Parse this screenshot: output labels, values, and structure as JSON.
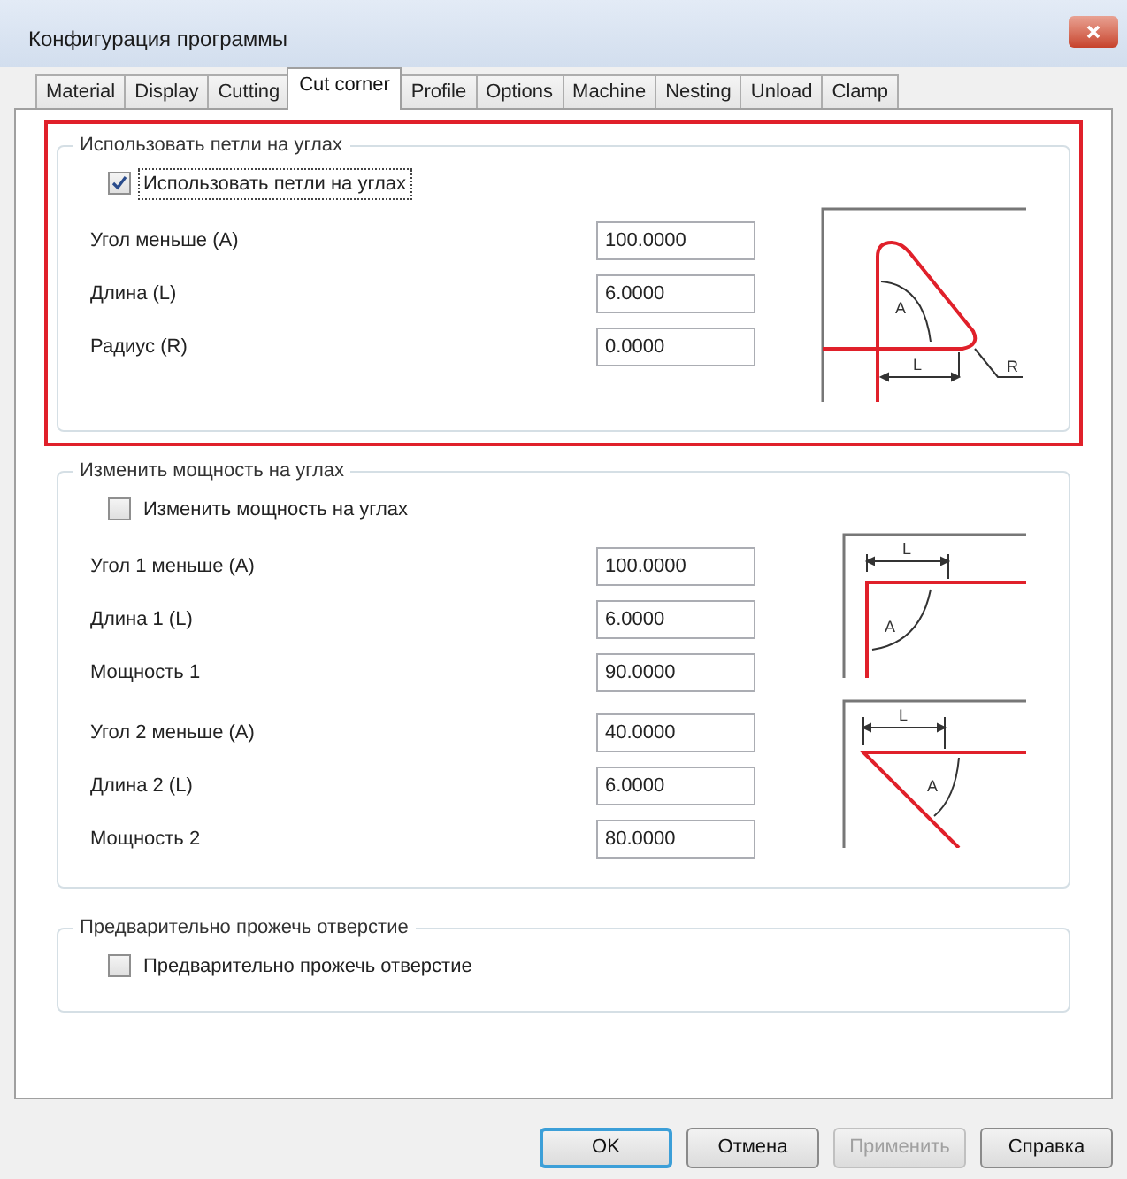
{
  "window": {
    "title": "Конфигурация программы"
  },
  "tabs": [
    {
      "label": "Material",
      "selected": false
    },
    {
      "label": "Display",
      "selected": false
    },
    {
      "label": "Cutting",
      "selected": false
    },
    {
      "label": "Cut corner",
      "selected": true
    },
    {
      "label": "Profile",
      "selected": false
    },
    {
      "label": "Options",
      "selected": false
    },
    {
      "label": "Machine",
      "selected": false
    },
    {
      "label": "Nesting",
      "selected": false
    },
    {
      "label": "Unload",
      "selected": false
    },
    {
      "label": "Clamp",
      "selected": false
    }
  ],
  "groups": [
    {
      "title": "Использовать петли на углах",
      "highlighted": true,
      "checkbox": {
        "label": "Использовать петли на углах",
        "checked": true
      },
      "blocks": [
        {
          "kind": "loop",
          "marks": [
            "A",
            "L",
            "R"
          ],
          "rows": [
            {
              "label": "Угол меньше (A)",
              "value": "100.0000"
            },
            {
              "label": "Длина (L)",
              "value": "6.0000"
            },
            {
              "label": "Радиус (R)",
              "value": "0.0000"
            }
          ]
        }
      ]
    },
    {
      "title": "Изменить мощность на углах",
      "highlighted": false,
      "checkbox": {
        "label": "Изменить мощность на углах",
        "checked": false
      },
      "blocks": [
        {
          "kind": "square",
          "marks": [
            "L",
            "A"
          ],
          "rows": [
            {
              "label": "Угол 1 меньше (A)",
              "value": "100.0000"
            },
            {
              "label": "Длина 1 (L)",
              "value": "6.0000"
            },
            {
              "label": "Мощность 1",
              "value": "90.0000"
            }
          ]
        },
        {
          "kind": "acute",
          "marks": [
            "L",
            "A"
          ],
          "rows": [
            {
              "label": "Угол 2 меньше (A)",
              "value": "40.0000"
            },
            {
              "label": "Длина 2 (L)",
              "value": "6.0000"
            },
            {
              "label": "Мощность 2",
              "value": "80.0000"
            }
          ]
        }
      ]
    },
    {
      "title": "Предварительно прожечь отверстие",
      "highlighted": false,
      "checkbox": {
        "label": "Предварительно прожечь отверстие",
        "checked": false
      }
    }
  ],
  "buttons": [
    {
      "label": "OK",
      "disabled": false,
      "default": true
    },
    {
      "label": "Отмена",
      "disabled": false,
      "default": false
    },
    {
      "label": "Применить",
      "disabled": true,
      "default": false
    },
    {
      "label": "Справка",
      "disabled": false,
      "default": false
    }
  ]
}
